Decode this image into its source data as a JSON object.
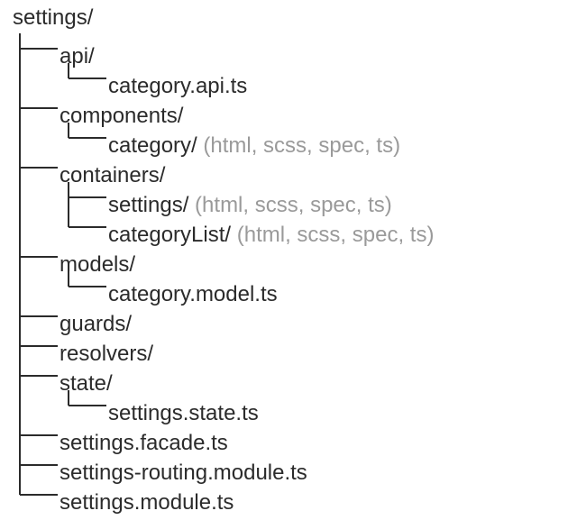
{
  "tree": {
    "root": "settings/",
    "api_dir": "api/",
    "api_file": "category.api.ts",
    "components_dir": "components/",
    "components_category": "category/",
    "containers_dir": "containers/",
    "containers_settings": "settings/",
    "containers_categoryList": "categoryList/",
    "models_dir": "models/",
    "models_file": "category.model.ts",
    "guards_dir": "guards/",
    "resolvers_dir": "resolvers/",
    "state_dir": "state/",
    "state_file": "settings.state.ts",
    "facade_file": "settings.facade.ts",
    "routing_file": "settings-routing.module.ts",
    "module_file": "settings.module.ts",
    "annot_bundle": " (html, scss, spec, ts)"
  }
}
